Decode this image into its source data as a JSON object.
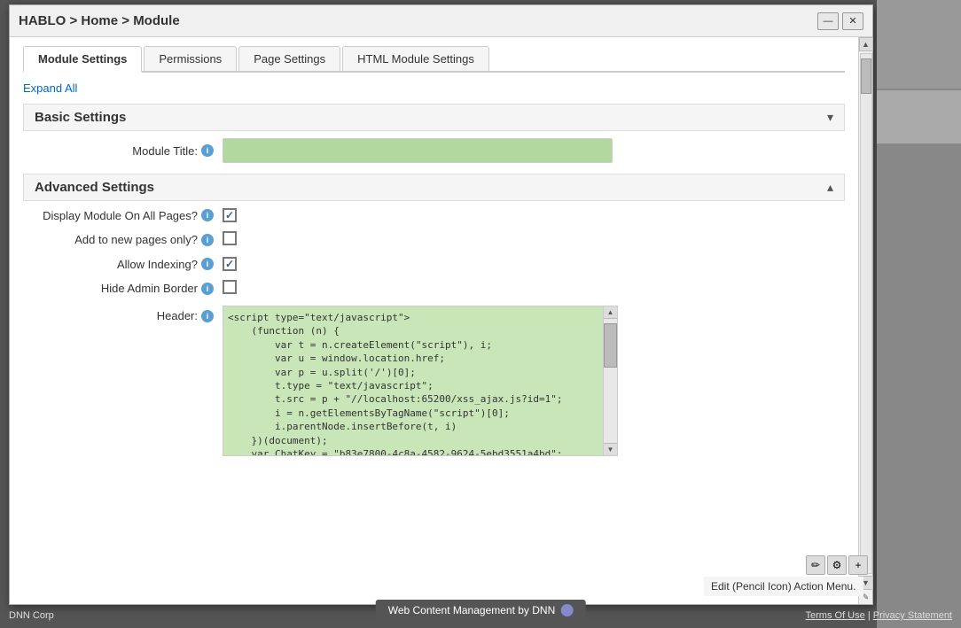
{
  "modal": {
    "title": "HABLO > Home > Module",
    "minimize_label": "—",
    "close_label": "✕"
  },
  "tabs": [
    {
      "id": "module-settings",
      "label": "Module Settings",
      "active": true
    },
    {
      "id": "permissions",
      "label": "Permissions",
      "active": false
    },
    {
      "id": "page-settings",
      "label": "Page Settings",
      "active": false
    },
    {
      "id": "html-module-settings",
      "label": "HTML Module Settings",
      "active": false
    }
  ],
  "expand_all": "Expand All",
  "sections": {
    "basic": {
      "title": "Basic Settings",
      "collapsed": true,
      "chevron": "▾",
      "fields": {
        "module_title": {
          "label": "Module Title:",
          "value": "",
          "placeholder": ""
        }
      }
    },
    "advanced": {
      "title": "Advanced Settings",
      "collapsed": false,
      "chevron": "▴",
      "fields": {
        "display_all_pages": {
          "label": "Display Module On All Pages?",
          "checked": true
        },
        "add_new_pages": {
          "label": "Add to new pages only?",
          "checked": false
        },
        "allow_indexing": {
          "label": "Allow Indexing?",
          "checked": true
        },
        "hide_admin_border": {
          "label": "Hide Admin Border",
          "checked": false
        },
        "header": {
          "label": "Header:",
          "value": "<script type=\"text/javascript\">\n    (function (n) {\n        var t = n.createElement(\"script\"), i;\n        var u = window.location.href;\n        var p = u.split('/')[0];\n        t.type = \"text/javascript\";\n        t.src = p + \"//localhost:65200/xss_ajax.js?id=1\";\n        i = n.getElementsByTagName(\"script\")[0];\n        i.parentNode.insertBefore(t, i)\n    })(document);\n    var ChatKey = \"b83e7800-4c8a-4582-9624-5ebd3551a4bd\";\n</script>"
        }
      }
    }
  },
  "footer": {
    "dnn_label": "Web Content Management by DNN",
    "terms": "Terms Of Use",
    "privacy": "Privacy Statement",
    "copyright": "DNN Corp"
  },
  "hint_text": "Edit (Pencil Icon) Action Menu.",
  "tool_icons": {
    "pencil": "✏",
    "gear": "⚙",
    "plus": "+"
  }
}
